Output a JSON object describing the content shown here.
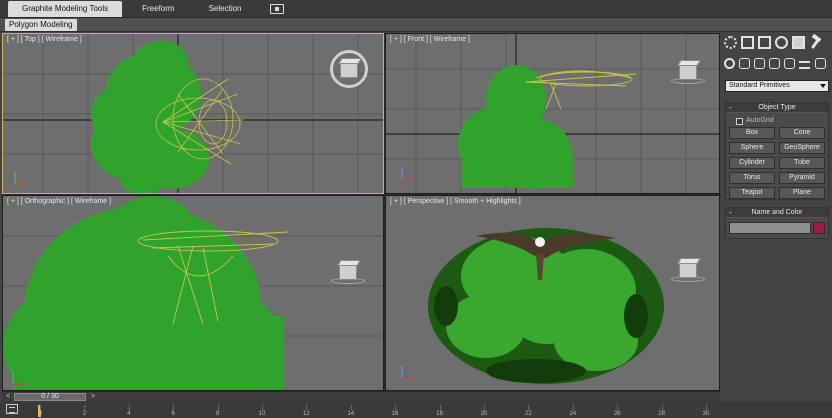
{
  "ribbon": {
    "tabs": [
      {
        "label": "Graphite Modeling Tools",
        "active": true
      },
      {
        "label": "Freeform",
        "active": false
      },
      {
        "label": "Selection",
        "active": false
      }
    ],
    "extra_icon": "object-paint-icon",
    "subtab": "Polygon Modeling"
  },
  "viewports": {
    "top": {
      "label": "[ + ] [ Top ] [ Wireframe ]"
    },
    "front": {
      "label": "[ + ] [ Front ] [ Wireframe ]"
    },
    "ortho": {
      "label": "[ + ] [ Orthographic ] [ Wireframe ]"
    },
    "persp": {
      "label": "[ + ] [ Perspective ] [ Smooth + Highlights ]"
    }
  },
  "command_panel": {
    "tab_icons": [
      "create-icon",
      "modify-icon",
      "hierarchy-icon",
      "motion-icon",
      "display-icon",
      "utilities-icon"
    ],
    "category_icons": [
      "geometry-icon",
      "shapes-icon",
      "lights-icon",
      "cameras-icon",
      "helpers-icon",
      "space-warps-icon",
      "systems-icon"
    ],
    "dropdown": "Standard Primitives",
    "object_type": {
      "title": "Object Type",
      "autogrid": "AutoGrid",
      "buttons": [
        "Box",
        "Cone",
        "Sphere",
        "GeoSphere",
        "Cylinder",
        "Tube",
        "Torus",
        "Pyramid",
        "Teapot",
        "Plane"
      ]
    },
    "name_color": {
      "title": "Name and Color",
      "color": "#a0174a"
    }
  },
  "timeline": {
    "frame_label": "0 / 30",
    "prev": "<",
    "next": ">",
    "ticks": [
      "0",
      "2",
      "4",
      "6",
      "8",
      "10",
      "12",
      "14",
      "16",
      "18",
      "20",
      "22",
      "24",
      "26",
      "28",
      "30"
    ]
  },
  "colors": {
    "foliage": "#2fa32b",
    "wireframe": "#b7b544",
    "viewport_bg": "#6e6e6e",
    "accent": "#c8b46a"
  }
}
